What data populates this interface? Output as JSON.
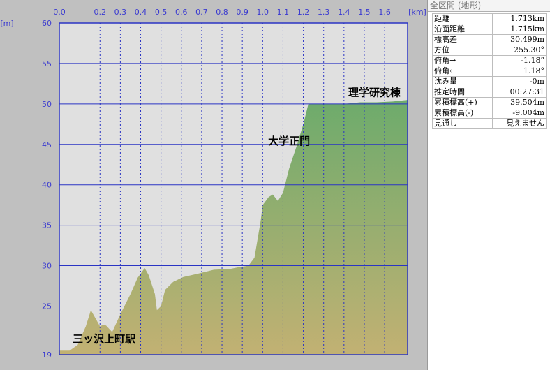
{
  "chart_data": {
    "type": "area",
    "x_unit": "[km]",
    "y_unit": "[m]",
    "xlim": [
      0,
      1.713
    ],
    "ylim": [
      19,
      60
    ],
    "x_ticks": [
      "0.0",
      "0.2",
      "0.3",
      "0.4",
      "0.5",
      "0.6",
      "0.7",
      "0.8",
      "0.9",
      "1.0",
      "1.1",
      "1.2",
      "1.3",
      "1.4",
      "1.5",
      "1.6"
    ],
    "x_tick_values": [
      0.0,
      0.2,
      0.3,
      0.4,
      0.5,
      0.6,
      0.7,
      0.8,
      0.9,
      1.0,
      1.1,
      1.2,
      1.3,
      1.4,
      1.5,
      1.6
    ],
    "y_ticks": [
      "60",
      "55",
      "50",
      "45",
      "40",
      "35",
      "30",
      "25",
      "19"
    ],
    "y_tick_values": [
      60,
      55,
      50,
      45,
      40,
      35,
      30,
      25,
      19
    ],
    "x": [
      0.0,
      0.05,
      0.09,
      0.13,
      0.155,
      0.2,
      0.215,
      0.23,
      0.26,
      0.3,
      0.35,
      0.385,
      0.42,
      0.44,
      0.47,
      0.48,
      0.5,
      0.52,
      0.56,
      0.61,
      0.68,
      0.76,
      0.84,
      0.88,
      0.93,
      0.96,
      0.99,
      1.0,
      1.03,
      1.05,
      1.075,
      1.1,
      1.13,
      1.17,
      1.2,
      1.225,
      1.25,
      1.32,
      1.4,
      1.48,
      1.56,
      1.64,
      1.713
    ],
    "values": [
      19.5,
      19.5,
      20.2,
      22.5,
      24.5,
      22.5,
      22.7,
      22.6,
      21.8,
      24.0,
      26.5,
      28.5,
      29.7,
      28.8,
      26.5,
      24.5,
      25.0,
      27.0,
      28.0,
      28.6,
      29.0,
      29.5,
      29.6,
      29.8,
      30.0,
      31.0,
      35.5,
      37.5,
      38.5,
      38.8,
      38.0,
      39.0,
      42.0,
      45.0,
      47.5,
      50.0,
      50.0,
      50.0,
      50.0,
      50.2,
      50.2,
      50.3,
      50.5
    ],
    "annotations": [
      {
        "text": "理学研究棟",
        "x": 1.55,
        "y": 51.0
      },
      {
        "text": "大学正門",
        "x": 1.13,
        "y": 45.0
      },
      {
        "text": "三ッ沢上町駅",
        "x": 0.22,
        "y": 20.5
      }
    ],
    "grid": true,
    "colors": {
      "plot_bg": "#e0e0e0",
      "grid": "#2a34c4",
      "axis_text": "#3a3ad0",
      "area_top": "#6dab6c",
      "area_bottom": "#c2b173"
    }
  },
  "info_panel": {
    "header": "全区間 (地形)",
    "rows": [
      {
        "label": "距離",
        "value": "1.713km"
      },
      {
        "label": "沿面距離",
        "value": "1.715km"
      },
      {
        "label": "標高差",
        "value": "30.499m"
      },
      {
        "label": "方位",
        "value": "255.30°"
      },
      {
        "label": "俯角→",
        "value": "-1.18°"
      },
      {
        "label": "俯角←",
        "value": "1.18°"
      },
      {
        "label": "沈み量",
        "value": "-0m"
      },
      {
        "label": "推定時間",
        "value": "00:27:31"
      },
      {
        "label": "累積標高(+)",
        "value": "39.504m"
      },
      {
        "label": "累積標高(-)",
        "value": "-9.004m"
      },
      {
        "label": "見通し",
        "value": "見えません"
      }
    ]
  }
}
